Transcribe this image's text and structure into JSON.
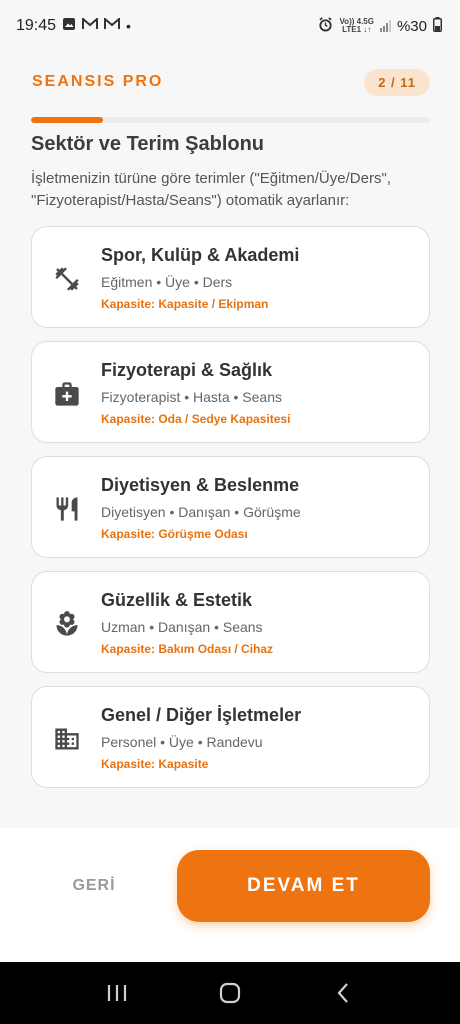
{
  "status_bar": {
    "time": "19:45",
    "notif_icons": [
      "image-icon",
      "gmail-icon",
      "gmail-icon"
    ],
    "dot": "•",
    "net_top": "Vo)) 4.5G",
    "net_bottom": "LTE1 ↓↑",
    "battery": "%30"
  },
  "header": {
    "brand": "SEANSIS PRO",
    "step": "2 / 11",
    "progress_fraction": 0.18
  },
  "page": {
    "title": "Sektör ve Terim Şablonu",
    "description": "İşletmenizin türüne göre terimler (\"Eğitmen/Üye/Ders\", \"Fizyoterapist/Hasta/Seans\") otomatik ayarlanır:"
  },
  "sectors": [
    {
      "icon": "dumbbell-icon",
      "title": "Spor, Kulüp & Akademi",
      "terms": "Eğitmen • Üye • Ders",
      "capacity": "Kapasite: Kapasite / Ekipman"
    },
    {
      "icon": "medical-kit-icon",
      "title": "Fizyoterapi & Sağlık",
      "terms": "Fizyoterapist • Hasta • Seans",
      "capacity": "Kapasite: Oda / Sedye Kapasitesi"
    },
    {
      "icon": "restaurant-icon",
      "title": "Diyetisyen & Beslenme",
      "terms": "Diyetisyen • Danışan • Görüşme",
      "capacity": "Kapasite: Görüşme Odası"
    },
    {
      "icon": "spa-icon",
      "title": "Güzellik & Estetik",
      "terms": "Uzman • Danışan • Seans",
      "capacity": "Kapasite: Bakım Odası / Cihaz"
    },
    {
      "icon": "building-icon",
      "title": "Genel / Diğer İşletmeler",
      "terms": "Personel • Üye • Randevu",
      "capacity": "Kapasite: Kapasite"
    }
  ],
  "footer": {
    "back_label": "GERİ",
    "next_label": "DEVAM ET"
  },
  "colors": {
    "accent": "#ee7411",
    "pill_bg": "#fbe4cf"
  }
}
